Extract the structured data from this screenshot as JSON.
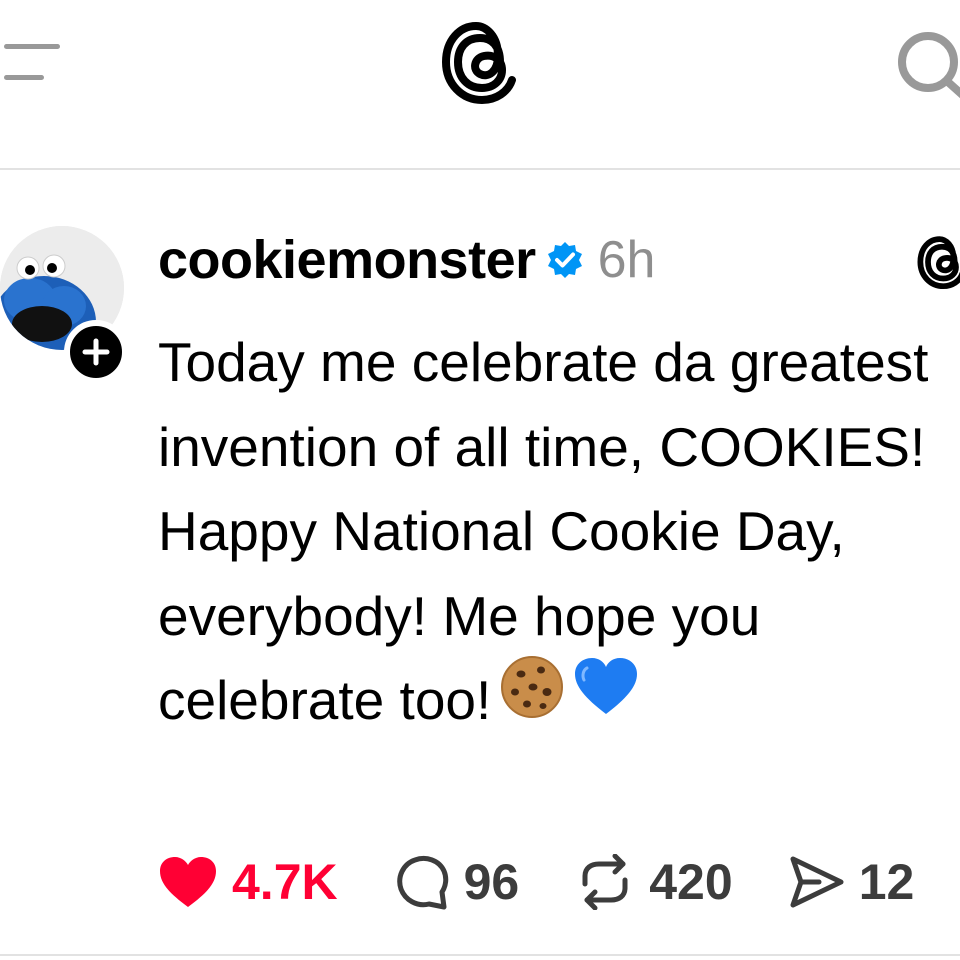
{
  "header": {
    "menu_icon": "menu-icon",
    "logo_icon": "threads-logo-icon",
    "search_icon": "search-icon"
  },
  "post": {
    "username": "cookiemonster",
    "verified_icon": "verified-badge-icon",
    "timestamp": "6h",
    "text": "Today me celebrate da greatest invention of all time, COOKIES! Happy National Cookie Day, everybody! Me hope you celebrate too!",
    "emojis": [
      "cookie-emoji",
      "blue-heart-emoji"
    ],
    "actions": {
      "likes": "4.7K",
      "replies": "96",
      "reposts": "420",
      "shares": "12"
    }
  },
  "colors": {
    "like": "#ff0034",
    "verified": "#0095f6",
    "muted": "#8e8e8e",
    "divider": "#e2e2e2"
  }
}
